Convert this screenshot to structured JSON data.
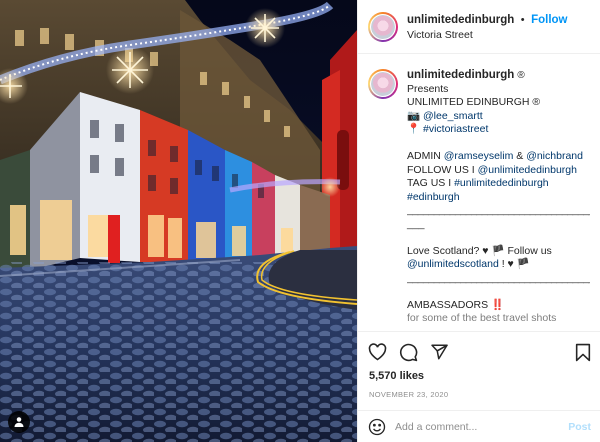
{
  "header": {
    "username": "unlimitededinburgh",
    "dot": "•",
    "follow_label": "Follow",
    "location": "Victoria Street"
  },
  "caption": {
    "username": "unlimitededinburgh",
    "verified_mark": "®",
    "lines": [
      "Presents",
      "UNLIMITED EDINBURGH ®"
    ],
    "camera_emoji": "📷",
    "photographer": "@lee_smartt",
    "pin_emoji": "📍",
    "location_tag": "#victoriastreet",
    "admin_prefix": "ADMIN ",
    "admin_1": "@ramseyselim",
    "admin_and": " & ",
    "admin_2": "@nichbrand",
    "follow_prefix": "FOLLOW US I ",
    "follow_handle": "@unlimitededinburgh",
    "tag_prefix": "TAG US I ",
    "tag_hashtag": "#unlimitededinburgh",
    "hashtag_edinburgh": "#edinburgh",
    "rule": "___________________________________",
    "rule_tail": "___",
    "love_text": "Love Scotland? ♥ 🏴 Follow us",
    "love_handle": "@unlimitedscotland",
    "love_suffix": " ! ♥ 🏴",
    "ambassadors": "AMBASSADORS ‼️",
    "faded_line": "for some of the best travel shots"
  },
  "actions": {
    "likes": "5,570 likes",
    "date": "NOVEMBER 23, 2020"
  },
  "comment": {
    "placeholder": "Add a comment...",
    "post_label": "Post"
  },
  "icons": {
    "like": "heart-icon",
    "comment": "comment-icon",
    "share": "share-icon",
    "save": "bookmark-icon",
    "emoji": "emoji-icon",
    "tags": "user-tag-icon"
  },
  "colors": {
    "accent": "#0095f6",
    "post_disabled": "#b2dffc",
    "link": "#00376b",
    "muted": "#8e8e8e"
  }
}
